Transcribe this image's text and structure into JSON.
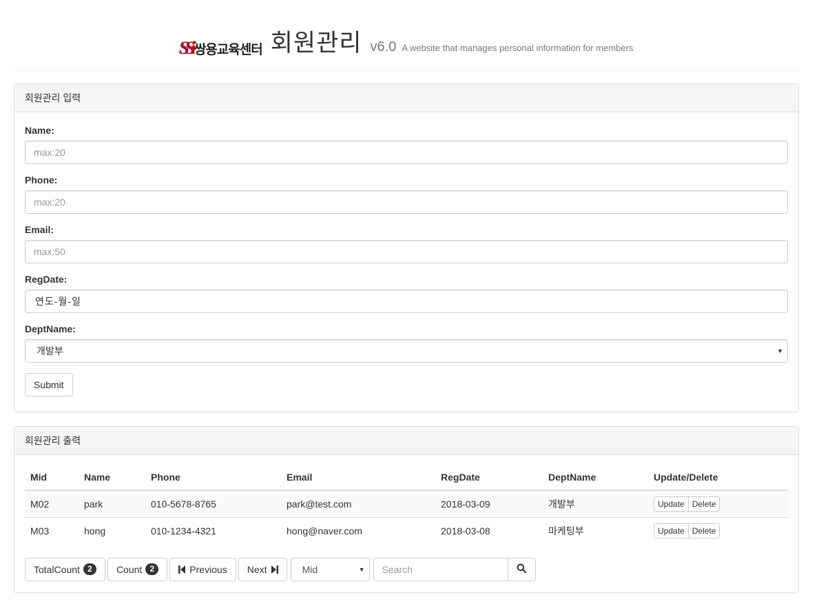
{
  "header": {
    "logo_mark": "SSi",
    "logo_text": "쌍용교육센터",
    "title": "회원관리",
    "version": "v6.0",
    "tagline": "A website that manages personal information for members"
  },
  "input_panel": {
    "heading": "회원관리 입력",
    "fields": {
      "name": {
        "label": "Name:",
        "placeholder": "max:20"
      },
      "phone": {
        "label": "Phone:",
        "placeholder": "max:20"
      },
      "email": {
        "label": "Email:",
        "placeholder": "max:50"
      },
      "regdate": {
        "label": "RegDate:",
        "value": "연도-월-일"
      },
      "deptname": {
        "label": "DeptName:",
        "value": "개발부"
      }
    },
    "submit_label": "Submit"
  },
  "output_panel": {
    "heading": "회원관리 출력",
    "columns": [
      "Mid",
      "Name",
      "Phone",
      "Email",
      "RegDate",
      "DeptName",
      "Update/Delete"
    ],
    "rows": [
      {
        "mid": "M02",
        "name": "park",
        "phone": "010-5678-8765",
        "email": "park@test.com",
        "regdate": "2018-03-09",
        "dept": "개발부"
      },
      {
        "mid": "M03",
        "name": "hong",
        "phone": "010-1234-4321",
        "email": "hong@naver.com",
        "regdate": "2018-03-08",
        "dept": "마케팅부"
      }
    ],
    "update_label": "Update",
    "delete_label": "Delete"
  },
  "pager": {
    "total_count_label": "TotalCount",
    "total_count": "2",
    "count_label": "Count",
    "count": "2",
    "previous_label": "Previous",
    "next_label": "Next",
    "search_key": "Mid",
    "search_placeholder": "Search",
    "icons": {
      "previous": "step-backward-icon",
      "next": "step-forward-icon",
      "search": "search-icon"
    }
  }
}
